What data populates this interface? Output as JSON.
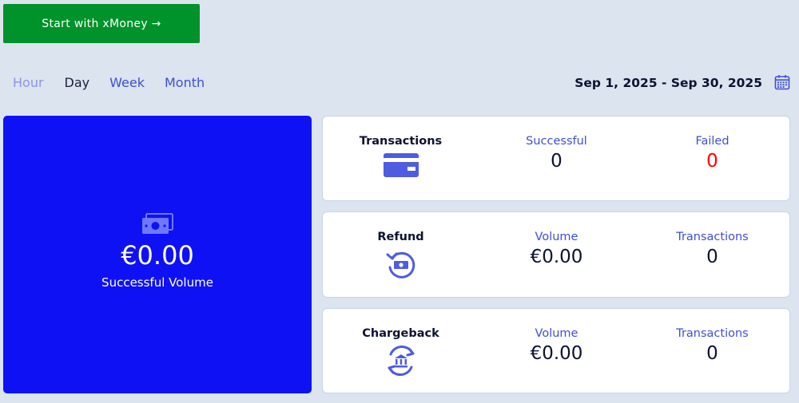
{
  "cta": {
    "label": "Start with xMoney →"
  },
  "period_tabs": [
    {
      "label": "Hour"
    },
    {
      "label": "Day"
    },
    {
      "label": "Week"
    },
    {
      "label": "Month"
    }
  ],
  "date_range": "Sep 1, 2025 - Sep 30, 2025",
  "volume": {
    "amount": "€0.00",
    "label": "Successful Volume"
  },
  "transactions": {
    "title": "Transactions",
    "successful_label": "Successful",
    "successful_value": "0",
    "failed_label": "Failed",
    "failed_value": "0"
  },
  "refund": {
    "title": "Refund",
    "volume_label": "Volume",
    "volume_value": "€0.00",
    "transactions_label": "Transactions",
    "transactions_value": "0"
  },
  "chargeback": {
    "title": "Chargeback",
    "volume_label": "Volume",
    "volume_value": "€0.00",
    "transactions_label": "Transactions",
    "transactions_value": "0"
  },
  "colors": {
    "accent": "#3d4fd6",
    "cta_green": "#00922b",
    "volume_blue": "#0f11f5",
    "failed_red": "#ff0000",
    "background": "#dbe4ef"
  },
  "icons": {
    "calendar": "calendar-icon",
    "volume": "cash-icon",
    "transactions": "credit-card-icon",
    "refund": "refund-icon",
    "chargeback": "bank-cycle-icon"
  }
}
